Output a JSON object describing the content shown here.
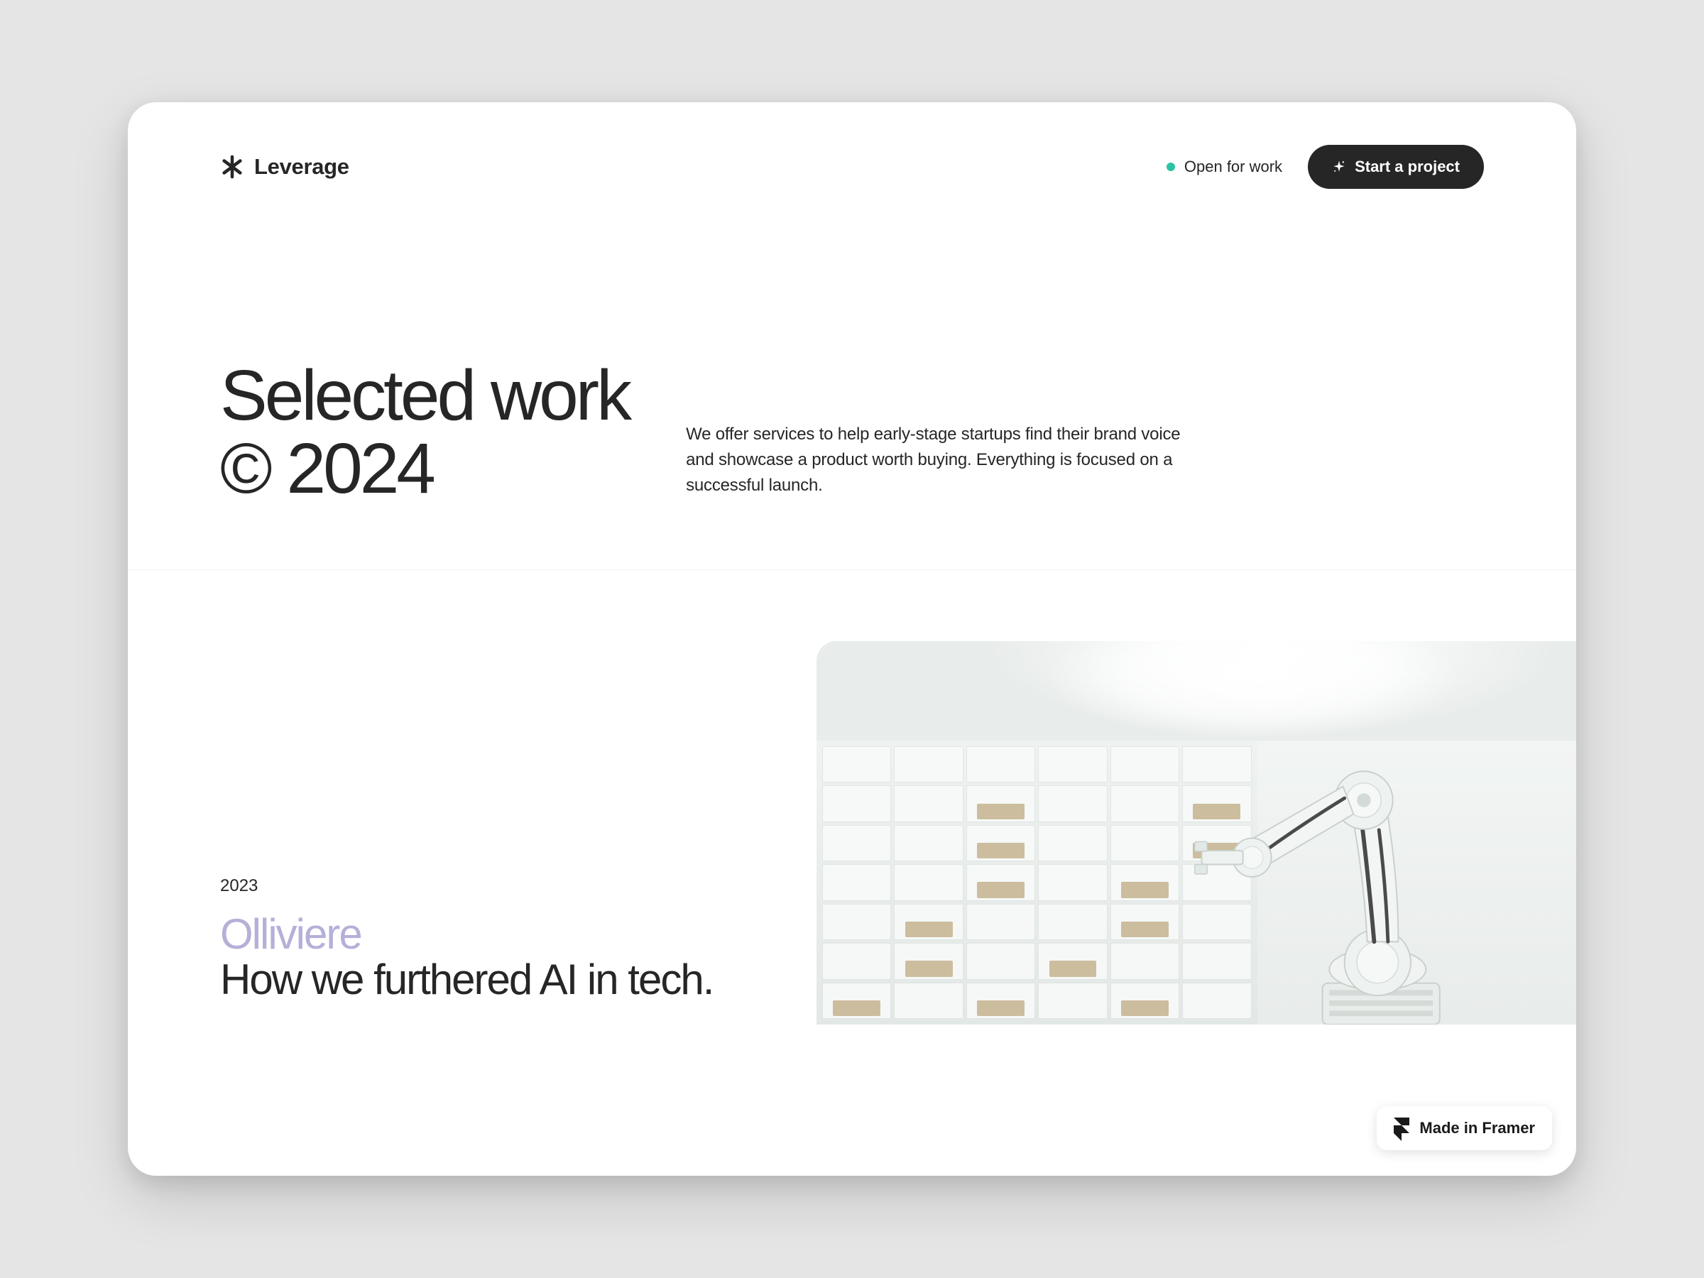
{
  "header": {
    "logo_text": "Leverage",
    "status_text": "Open for work",
    "cta_label": "Start a project"
  },
  "hero": {
    "title_line1": "Selected work",
    "title_line2": "© 2024",
    "description": "We offer services to help early-stage startups find their brand voice and showcase a product worth buying. Everything is focused on a successful launch."
  },
  "project": {
    "year": "2023",
    "name": "Olliviere",
    "headline": "How we furthered AI in tech."
  },
  "badge": {
    "label": "Made in Framer"
  },
  "colors": {
    "text": "#262626",
    "accent_lavender": "#b4b0d8",
    "status_teal": "#2cc2a5",
    "background": "#e5e5e5"
  }
}
